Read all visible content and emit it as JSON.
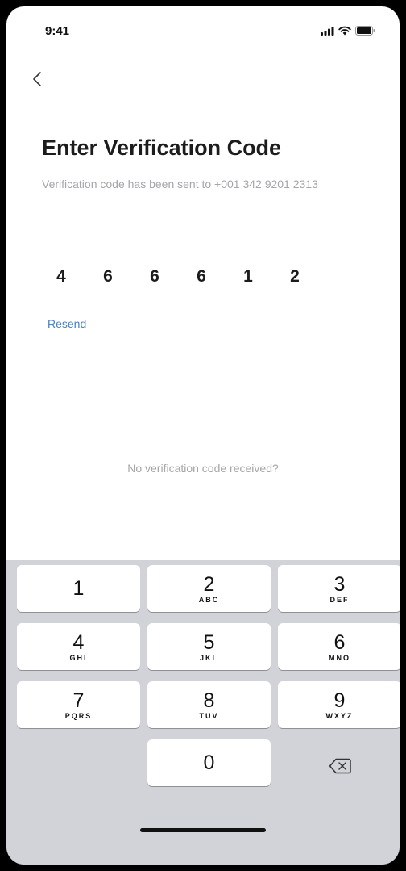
{
  "status_bar": {
    "time": "9:41",
    "icons": [
      "cellular-signal-icon",
      "wifi-icon",
      "battery-icon"
    ]
  },
  "nav": {
    "back_icon": "chevron-left-icon"
  },
  "content": {
    "title": "Enter Verification Code",
    "subtitle": "Verification code has been sent to +001 342 9201 2313",
    "code_digits": [
      "4",
      "6",
      "6",
      "6",
      "1",
      "2"
    ],
    "resend_label": "Resend",
    "no_code_text": "No verification code received?"
  },
  "keypad": {
    "keys": [
      {
        "digit": "1",
        "letters": ""
      },
      {
        "digit": "2",
        "letters": "ABC"
      },
      {
        "digit": "3",
        "letters": "DEF"
      },
      {
        "digit": "4",
        "letters": "GHI"
      },
      {
        "digit": "5",
        "letters": "JKL"
      },
      {
        "digit": "6",
        "letters": "MNO"
      },
      {
        "digit": "7",
        "letters": "PQRS"
      },
      {
        "digit": "8",
        "letters": "TUV"
      },
      {
        "digit": "9",
        "letters": "WXYZ"
      },
      {
        "digit": "0",
        "letters": ""
      }
    ],
    "delete_icon": "backspace-icon"
  },
  "colors": {
    "accent": "#4a7fc0",
    "muted_text": "#a5a5aa",
    "keypad_background": "#d1d3d9"
  }
}
